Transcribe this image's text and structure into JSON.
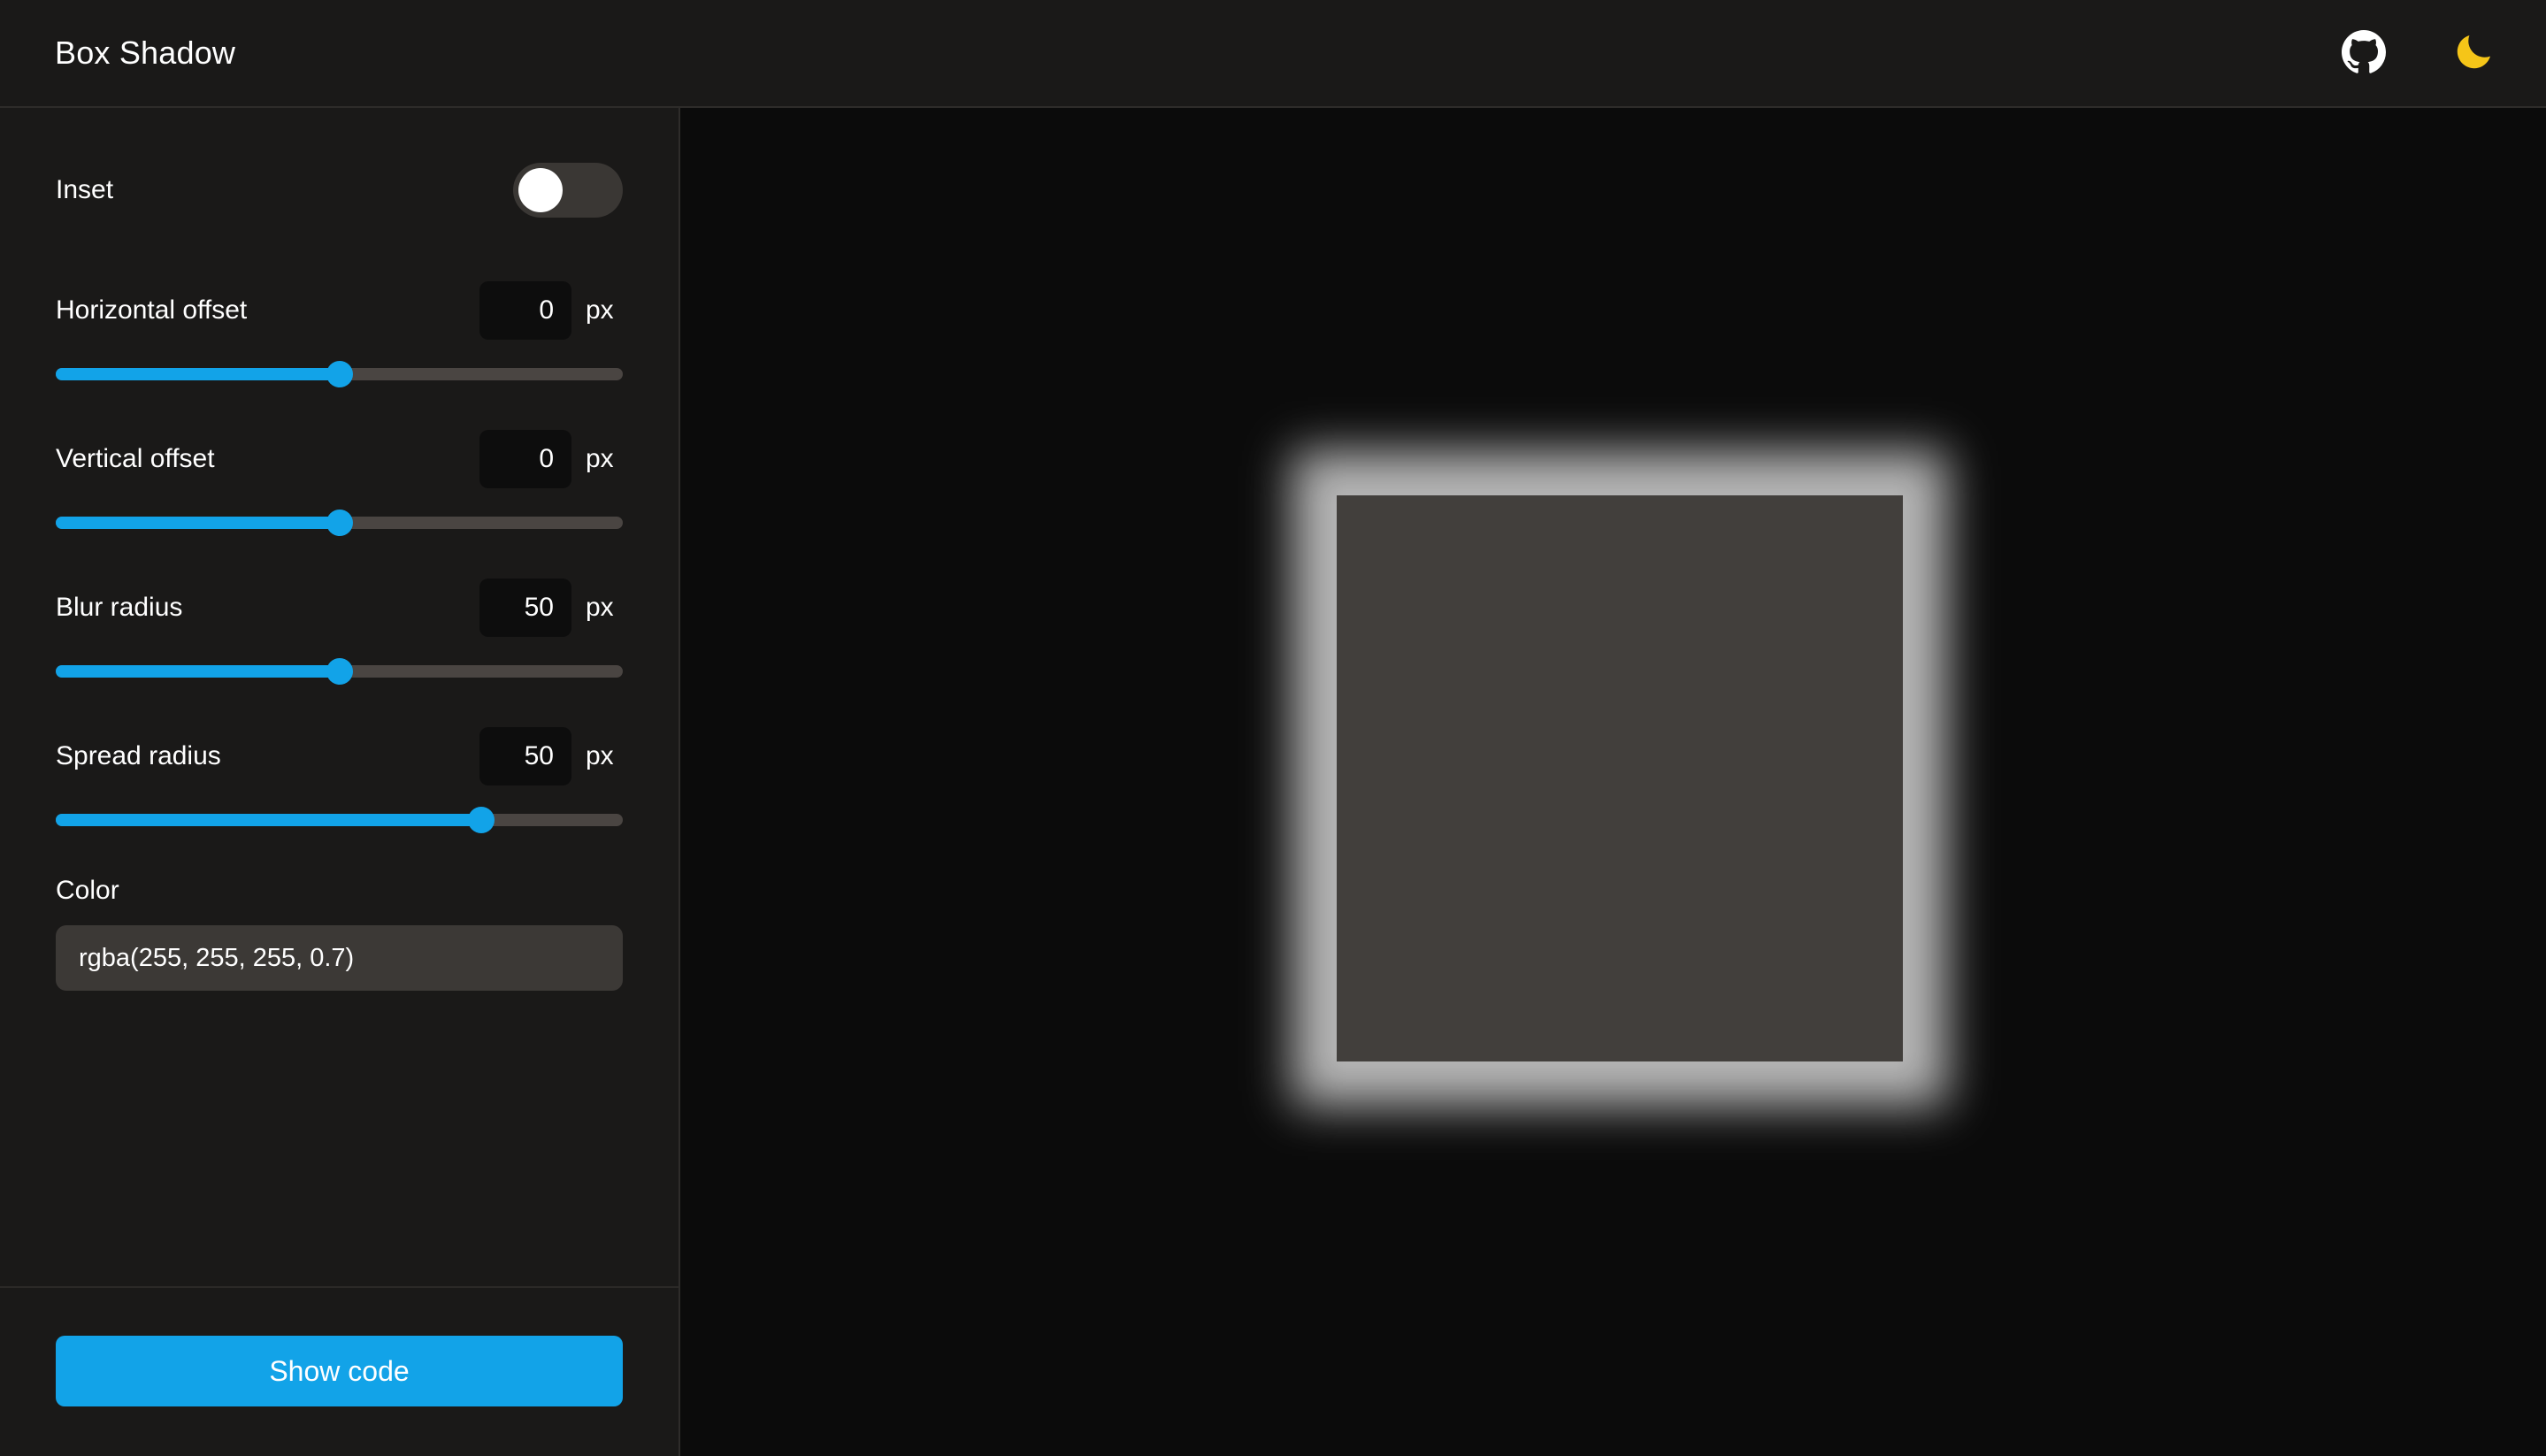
{
  "header": {
    "title": "Box Shadow",
    "github_icon": "github-icon",
    "theme_icon": "moon-icon",
    "accent_color": "#12a3e8",
    "moon_color": "#f5c518"
  },
  "sidebar": {
    "inset": {
      "label": "Inset",
      "value": "off"
    },
    "sliders": [
      {
        "label": "Horizontal offset",
        "value": "0",
        "unit": "px",
        "percent": 50
      },
      {
        "label": "Vertical offset",
        "value": "0",
        "unit": "px",
        "percent": 50
      },
      {
        "label": "Blur radius",
        "value": "50",
        "unit": "px",
        "percent": 50
      },
      {
        "label": "Spread radius",
        "value": "50",
        "unit": "px",
        "percent": 75
      }
    ],
    "color": {
      "label": "Color",
      "value": "rgba(255, 255, 255, 0.7)",
      "placeholder": "rgba(255, 255, 255, 0.7)"
    },
    "footer": {
      "show_code_label": "Show code"
    }
  },
  "preview": {
    "box_color": "#423f3c",
    "background_color": "#0b0b0b",
    "shadow": "0px 0px 50px 50px rgba(255, 255, 255, 0.7)"
  }
}
